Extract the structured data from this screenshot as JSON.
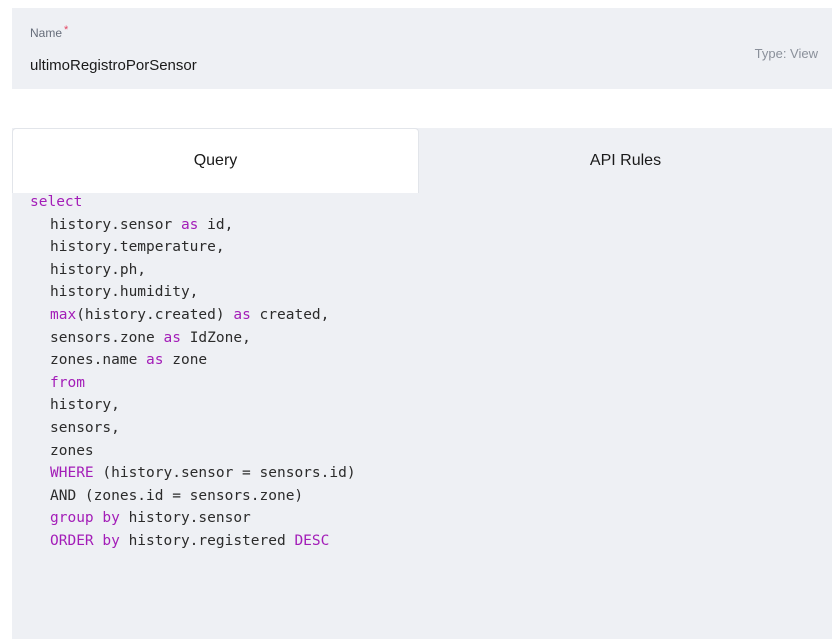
{
  "name_field": {
    "label": "Name",
    "required_mark": "*",
    "value": "ultimoRegistroPorSensor",
    "type_label": "Type: View"
  },
  "tabs": [
    {
      "label": "Query",
      "active": true
    },
    {
      "label": "API Rules",
      "active": false
    }
  ],
  "colors": {
    "keyword": "#a31db8",
    "panel_bg": "#eef0f4",
    "required": "#e34562"
  },
  "query_lines": [
    {
      "indent": 0,
      "segments": [
        {
          "text": "select",
          "kw": true
        }
      ]
    },
    {
      "indent": 1,
      "segments": [
        {
          "text": "history.sensor ",
          "kw": false
        },
        {
          "text": "as",
          "kw": true
        },
        {
          "text": " id,",
          "kw": false
        }
      ]
    },
    {
      "indent": 1,
      "segments": [
        {
          "text": "history.temperature,",
          "kw": false
        }
      ]
    },
    {
      "indent": 1,
      "segments": [
        {
          "text": "history.ph,",
          "kw": false
        }
      ]
    },
    {
      "indent": 1,
      "segments": [
        {
          "text": "history.humidity,",
          "kw": false
        }
      ]
    },
    {
      "indent": 1,
      "segments": [
        {
          "text": "max",
          "kw": true
        },
        {
          "text": "(history.created) ",
          "kw": false
        },
        {
          "text": "as",
          "kw": true
        },
        {
          "text": " created,",
          "kw": false
        }
      ]
    },
    {
      "indent": 1,
      "segments": [
        {
          "text": "sensors.zone ",
          "kw": false
        },
        {
          "text": "as",
          "kw": true
        },
        {
          "text": " IdZone,",
          "kw": false
        }
      ]
    },
    {
      "indent": 1,
      "segments": [
        {
          "text": "zones.name ",
          "kw": false
        },
        {
          "text": "as",
          "kw": true
        },
        {
          "text": " zone",
          "kw": false
        }
      ]
    },
    {
      "indent": 1,
      "segments": [
        {
          "text": "from",
          "kw": true
        }
      ]
    },
    {
      "indent": 1,
      "segments": [
        {
          "text": "history,",
          "kw": false
        }
      ]
    },
    {
      "indent": 1,
      "segments": [
        {
          "text": "sensors,",
          "kw": false
        }
      ]
    },
    {
      "indent": 1,
      "segments": [
        {
          "text": "zones",
          "kw": false
        }
      ]
    },
    {
      "indent": 1,
      "segments": [
        {
          "text": "WHERE",
          "kw": true
        },
        {
          "text": " (history.sensor = sensors.id)",
          "kw": false
        }
      ]
    },
    {
      "indent": 1,
      "segments": [
        {
          "text": "AND (zones.id = sensors.zone)",
          "kw": false
        }
      ]
    },
    {
      "indent": 1,
      "segments": [
        {
          "text": "group by",
          "kw": true
        },
        {
          "text": " history.sensor",
          "kw": false
        }
      ]
    },
    {
      "indent": 1,
      "segments": [
        {
          "text": "ORDER by",
          "kw": true
        },
        {
          "text": " history.registered ",
          "kw": false
        },
        {
          "text": "DESC",
          "kw": true
        }
      ]
    }
  ]
}
